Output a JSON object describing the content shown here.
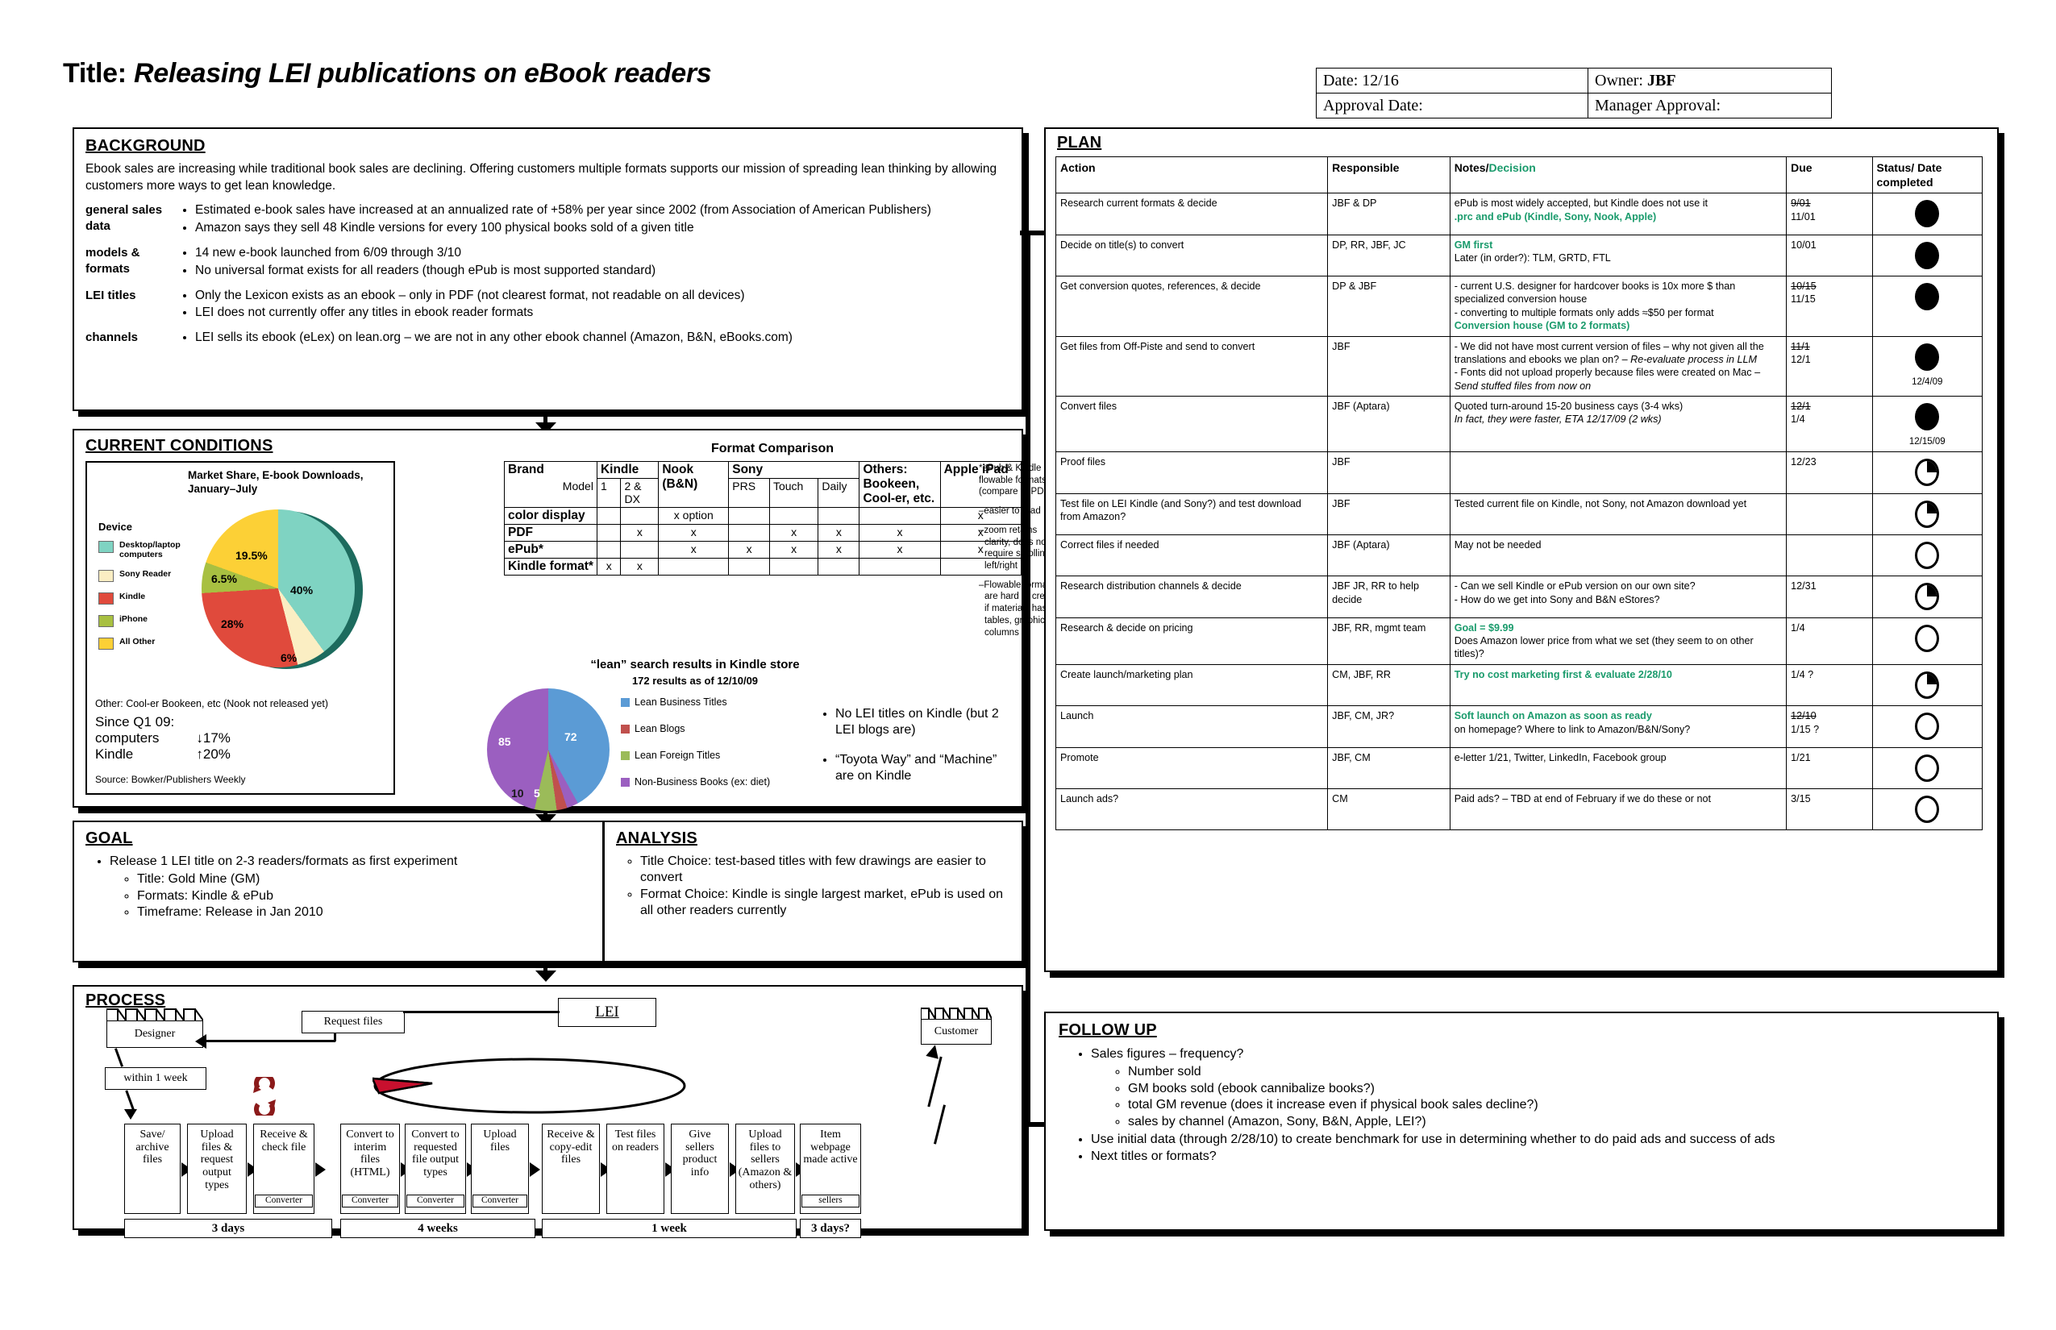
{
  "title": {
    "prefix": "Title:",
    "text": "Releasing LEI publications on eBook readers"
  },
  "meta": {
    "date_label": "Date: 12/16",
    "owner_label": "Owner:",
    "owner_value": "JBF",
    "approval_date_label": "Approval Date:",
    "manager_approval_label": "Manager Approval:"
  },
  "background": {
    "heading": "BACKGROUND",
    "intro": "Ebook sales are increasing while traditional book sales are declining. Offering customers multiple formats supports our mission of spreading lean thinking by allowing customers more ways to get lean knowledge.",
    "rows": [
      {
        "label": "general sales data",
        "items": [
          "Estimated e-book sales have increased at an annualized rate of +58% per year since 2002 (from Association of American Publishers)",
          "Amazon says they sell 48 Kindle versions for every 100 physical books sold of a given title"
        ]
      },
      {
        "label": "models & formats",
        "items": [
          "14 new e-book launched from 6/09 through 3/10",
          "No universal format exists for all readers (though ePub is most supported standard)"
        ]
      },
      {
        "label": "LEI titles",
        "items": [
          "Only the Lexicon exists as an ebook – only in PDF (not clearest format, not readable on all devices)",
          "LEI does not currently offer any titles in ebook reader formats"
        ]
      },
      {
        "label": "channels",
        "items": [
          "LEI sells its ebook (eLex) on lean.org – we are not in any other ebook channel (Amazon, B&N, eBooks.com)"
        ]
      }
    ]
  },
  "current_conditions": {
    "heading": "CURRENT CONDITIONS",
    "pie_note": "Other: Cool-er Bookeen, etc (Nook not released yet)",
    "since_label": "Since Q1 09:",
    "since_rows": [
      {
        "label": "computers",
        "value": "↓17%"
      },
      {
        "label": "Kindle",
        "value": "↑20%"
      }
    ],
    "source": "Source: Bowker/Publishers Weekly",
    "format_title": "Format Comparison",
    "format_notes_head": "*ePub & Kindle are flowable formats (compare to PDF",
    "format_notes": [
      {
        "lead": "–easier to read",
        "cont": []
      },
      {
        "lead": "–zoom retains",
        "cont": [
          "clarity, does not",
          "require scrolling",
          "left/right"
        ]
      },
      {
        "lead": "–Flowable formats",
        "cont": [
          "are hard to create",
          "if materials has",
          "tables, graphics,",
          "columns"
        ]
      }
    ],
    "lean_bullets": [
      "No LEI titles on Kindle (but 2 LEI blogs are)",
      "“Toyota Way” and “Machine” are on Kindle"
    ]
  },
  "chart_data": [
    {
      "type": "pie",
      "title": "Market Share, E-book Downloads, January–July",
      "legend_title": "Device",
      "legend_position": "left",
      "categories": [
        "Desktop/laptop computers",
        "Sony Reader",
        "Kindle",
        "iPhone",
        "All Other"
      ],
      "values": [
        40,
        6,
        28,
        6.5,
        19.5
      ],
      "value_labels": [
        "40%",
        "6%",
        "28%",
        "6.5%",
        "19.5%"
      ],
      "colors": [
        "#7fd3c2",
        "#fbeec3",
        "#e04a3c",
        "#a8c041",
        "#fcd036"
      ],
      "note": "Other: Cool-er Bookeen, etc (Nook not released yet)",
      "source": "Source: Bowker/Publishers Weekly"
    },
    {
      "type": "pie",
      "title": "“lean” search results in Kindle store",
      "subtitle": "172 results as of 12/10/09",
      "legend_position": "right",
      "categories": [
        "Lean Business Titles",
        "Lean Blogs",
        "Lean Foreign Titles",
        "Non-Business Books (ex: diet)"
      ],
      "values": [
        72,
        5,
        10,
        85
      ],
      "value_labels": [
        "72",
        "5",
        "10",
        "85"
      ],
      "colors": [
        "#5b9bd5",
        "#c0504d",
        "#9bbb59",
        "#9b5fc0"
      ]
    },
    {
      "type": "table",
      "title": "Format Comparison",
      "columns": [
        "Brand / Model",
        "Kindle 1",
        "Kindle 2 & DX",
        "Nook (B&N)",
        "Sony PRS",
        "Sony Touch",
        "Sony Daily",
        "Others: Bookeen, Cool-er, etc.",
        "Apple iPad"
      ],
      "rows": [
        {
          "label": "color display",
          "cells": [
            "",
            "",
            "x option",
            "",
            "",
            "",
            "",
            "x"
          ]
        },
        {
          "label": "PDF",
          "cells": [
            "",
            "x",
            "x",
            "",
            "x",
            "x",
            "x",
            "x"
          ]
        },
        {
          "label": "ePub*",
          "cells": [
            "",
            "",
            "x",
            "x",
            "x",
            "x",
            "x",
            "x"
          ]
        },
        {
          "label": "Kindle format*",
          "cells": [
            "x",
            "x",
            "",
            "",
            "",
            "",
            "",
            ""
          ]
        }
      ]
    }
  ],
  "format_table": {
    "brand_label": "Brand",
    "model_label": "Model",
    "groups": [
      {
        "name": "Kindle",
        "models": [
          "1",
          "2 & DX"
        ]
      },
      {
        "name": "Nook (B&N)",
        "models": []
      },
      {
        "name": "Sony",
        "models": [
          "PRS",
          "Touch",
          "Daily"
        ]
      },
      {
        "name": "Others: Bookeen, Cool-er, etc.",
        "models": []
      },
      {
        "name": "Apple iPad",
        "models": []
      }
    ],
    "rows": [
      {
        "label": "color display",
        "cells": [
          "",
          "",
          "x option",
          "",
          "",
          "",
          "",
          "x"
        ]
      },
      {
        "label": "PDF",
        "cells": [
          "",
          "x",
          "x",
          "",
          "x",
          "x",
          "x",
          "x"
        ]
      },
      {
        "label": "ePub*",
        "cells": [
          "",
          "",
          "x",
          "x",
          "x",
          "x",
          "x",
          "x"
        ]
      },
      {
        "label": "Kindle format*",
        "cells": [
          "x",
          "x",
          "",
          "",
          "",
          "",
          "",
          ""
        ]
      }
    ]
  },
  "goal": {
    "heading": "GOAL",
    "main": "Release 1 LEI title on 2-3 readers/formats as first experiment",
    "subs": [
      "Title: Gold Mine (GM)",
      "Formats: Kindle & ePub",
      "Timeframe: Release in Jan 2010"
    ]
  },
  "analysis": {
    "heading": "ANALYSIS",
    "items": [
      "Title Choice: test-based titles with few drawings are easier to convert",
      "Format Choice: Kindle is single largest market, ePub is used on all other readers currently"
    ]
  },
  "process": {
    "heading": "PROCESS",
    "designer": "Designer",
    "customer": "Customer",
    "lei": "LEI",
    "request_files": "Request files",
    "within": "within 1 week",
    "steps": [
      {
        "text": "Save/ archive files",
        "tag": ""
      },
      {
        "text": "Upload files & request output types",
        "tag": ""
      },
      {
        "text": "Receive & check file",
        "tag": "Converter"
      },
      {
        "text": "Convert to interim files (HTML)",
        "tag": "Converter"
      },
      {
        "text": "Convert to requested file output types",
        "tag": "Converter"
      },
      {
        "text": "Upload files",
        "tag": "Converter"
      },
      {
        "text": "Receive & copy-edit files",
        "tag": ""
      },
      {
        "text": "Test files on readers",
        "tag": ""
      },
      {
        "text": "Give sellers product info",
        "tag": ""
      },
      {
        "text": "Upload files to sellers (Amazon & others)",
        "tag": ""
      },
      {
        "text": "Item webpage made active",
        "tag": "sellers"
      }
    ],
    "timebars": [
      "3 days",
      "4 weeks",
      "1 week",
      "3 days?"
    ]
  },
  "plan": {
    "heading": "PLAN",
    "columns": [
      "Action",
      "Responsible",
      "Notes/Decision",
      "Due",
      "Status/ Date completed"
    ],
    "notes_header_a": "Notes/",
    "notes_header_b": "Decision",
    "status_header_a": "Status/ Date",
    "status_header_b": "completed",
    "rows": [
      {
        "action": "Research current formats & decide",
        "responsible": "JBF & DP",
        "notes": [
          "ePub is most widely accepted, but Kindle does not use it"
        ],
        "decision": ".prc and ePub (Kindle, Sony, Nook, Apple)",
        "due_old": "9/01",
        "due": "11/01",
        "status": "full",
        "status_date": ""
      },
      {
        "action": "Decide on title(s) to convert",
        "responsible": "DP, RR, JBF, JC",
        "decision_first": "GM first",
        "notes": [
          "Later (in order?): TLM, GRTD, FTL"
        ],
        "due_old": "",
        "due": "10/01",
        "status": "full",
        "status_date": ""
      },
      {
        "action": "Get conversion quotes, references, & decide",
        "responsible": "DP & JBF",
        "notes": [
          "- current U.S. designer for hardcover books is 10x more $ than specialized conversion house",
          "- converting to multiple formats only adds ≈$50 per format"
        ],
        "decision": "Conversion house (GM to 2 formats)",
        "due_old": "10/15",
        "due": "11/15",
        "status": "full",
        "status_date": ""
      },
      {
        "action": "Get files from Off-Piste and send to convert",
        "responsible": "JBF",
        "notes": [
          "- We did not have most current version of files – why not given all the translations and ebooks we plan on? – ",
          "- Fonts did not upload properly because files were created on Mac – "
        ],
        "italics": [
          "Re-evaluate process in LLM",
          "Send stuffed files from now on"
        ],
        "due_old": "11/1",
        "due": "12/1",
        "status": "full",
        "status_date": "12/4/09"
      },
      {
        "action": "Convert files",
        "responsible": "JBF (Aptara)",
        "notes": [
          "Quoted turn-around 15-20 business cays (3-4 wks)"
        ],
        "italic_note": "In fact, they were faster, ETA 12/17/09 (2 wks)",
        "due_old": "12/1",
        "due": "1/4",
        "status": "full",
        "status_date": "12/15/09"
      },
      {
        "action": "Proof files",
        "responsible": "JBF",
        "notes": [
          ""
        ],
        "due_old": "",
        "due": "12/23",
        "status": "quarter",
        "status_date": ""
      },
      {
        "action": "Test file on LEI Kindle (and Sony?) and test download from Amazon?",
        "responsible": "JBF",
        "notes": [
          "Tested current file on Kindle, not Sony, not Amazon download yet"
        ],
        "due_old": "",
        "due": "",
        "status": "quarter",
        "status_date": ""
      },
      {
        "action": "Correct files if needed",
        "responsible": "JBF (Aptara)",
        "notes": [
          "May not be needed"
        ],
        "due_old": "",
        "due": "",
        "status": "empty",
        "status_date": ""
      },
      {
        "action": "Research distribution channels & decide",
        "responsible": "JBF JR, RR to help decide",
        "notes": [
          "- Can we sell Kindle or ePub version on our own site?",
          "- How do we get into Sony and B&N eStores?"
        ],
        "due_old": "",
        "due": "12/31",
        "status": "quarter",
        "status_date": ""
      },
      {
        "action": "Research & decide on pricing",
        "responsible": "JBF, RR, mgmt team",
        "decision_first": "Goal = $9.99",
        "notes": [
          "Does Amazon lower price from what we set (they seem to on other titles)?"
        ],
        "due_old": "",
        "due": "1/4",
        "status": "empty",
        "status_date": ""
      },
      {
        "action": "Create launch/marketing plan",
        "responsible": "CM, JBF, RR",
        "decision_first": "Try no cost marketing first & evaluate 2/28/10",
        "notes": [],
        "due_old": "",
        "due": "1/4 ?",
        "status": "quarter",
        "status_date": ""
      },
      {
        "action": "Launch",
        "responsible": "JBF, CM, JR?",
        "decision_first": "Soft launch on Amazon as soon as ready",
        "notes": [
          "on homepage? Where to link to Amazon/B&N/Sony?"
        ],
        "due_old": "12/10",
        "due": "1/15 ?",
        "status": "empty",
        "status_date": ""
      },
      {
        "action": "Promote",
        "responsible": "JBF, CM",
        "notes": [
          "e-letter 1/21, Twitter, LinkedIn, Facebook group"
        ],
        "due_old": "",
        "due": "1/21",
        "status": "empty",
        "status_date": ""
      },
      {
        "action": "Launch ads?",
        "responsible": "CM",
        "notes": [
          "Paid ads? – TBD at end of February if we do these or not"
        ],
        "due_old": "",
        "due": "3/15",
        "status": "empty",
        "status_date": ""
      }
    ]
  },
  "followup": {
    "heading": "FOLLOW UP",
    "item1": "Sales figures – frequency?",
    "subs": [
      "Number sold",
      "GM books sold (ebook cannibalize books?)",
      "total GM revenue (does it increase even if physical book sales decline?)",
      "sales by channel (Amazon, Sony, B&N, Apple, LEI?)"
    ],
    "item2": "Use initial data (through 2/28/10) to create benchmark for use in determining whether to do paid ads and success of ads",
    "item3": "Next titles or formats?"
  },
  "colors": {
    "accent_green": "#1a9b6c",
    "ink": "#000000"
  }
}
